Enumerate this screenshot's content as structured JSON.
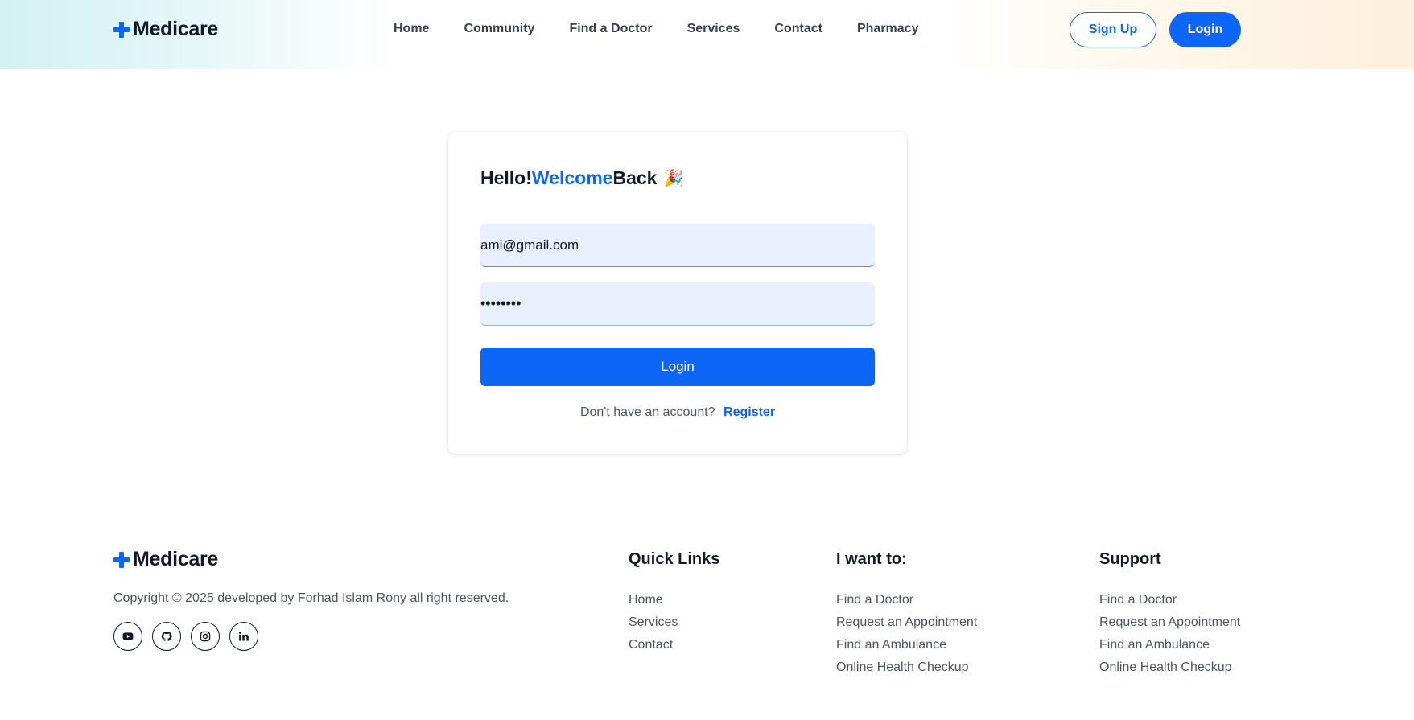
{
  "header": {
    "logo_text": "Medicare",
    "nav": [
      "Home",
      "Community",
      "Find a Doctor",
      "Services",
      "Contact",
      "Pharmacy"
    ],
    "signup_label": "Sign Up",
    "login_label": "Login"
  },
  "login_card": {
    "title_part1": "Hello! ",
    "title_accent": "Welcome",
    "title_part2": "Back",
    "title_emoji": "🎉",
    "email_value": "ami@gmail.com",
    "password_value": "ami12345",
    "login_button": "Login",
    "no_account_text": "Don't have an account?",
    "register_link": "Register"
  },
  "footer": {
    "logo_text": "Medicare",
    "copyright": "Copyright © 2025 developed by Forhad Islam Rony all right reserved.",
    "social_icons": [
      "youtube-icon",
      "github-icon",
      "instagram-icon",
      "linkedin-icon"
    ],
    "quick_links": {
      "title": "Quick Links",
      "items": [
        "Home",
        "Services",
        "Contact"
      ]
    },
    "i_want_to": {
      "title": "I want to:",
      "items": [
        "Find a Doctor",
        "Request an Appointment",
        "Find an Ambulance",
        "Online Health Checkup"
      ]
    },
    "support": {
      "title": "Support",
      "items": [
        "Find a Doctor",
        "Request an Appointment",
        "Find an Ambulance",
        "Online Health Checkup"
      ]
    }
  },
  "colors": {
    "brand_blue": "#0d66f5",
    "input_bg": "#e8f0fe"
  }
}
